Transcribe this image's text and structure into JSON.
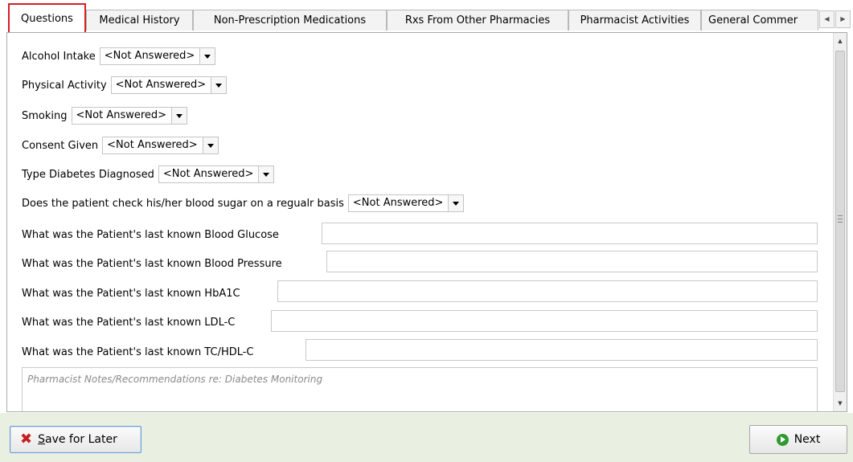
{
  "tabs": [
    {
      "label": "Questions",
      "active": true
    },
    {
      "label": "Medical History",
      "active": false
    },
    {
      "label": "Non-Prescription Medications",
      "active": false
    },
    {
      "label": "Rxs From Other Pharmacies",
      "active": false
    },
    {
      "label": "Pharmacist Activities",
      "active": false
    },
    {
      "label": "General Commer",
      "active": false
    }
  ],
  "tab_scroll": {
    "left_icon": "arrow-left-small-icon",
    "right_icon": "arrow-right-small-icon"
  },
  "questions": {
    "alcohol": {
      "label": "Alcohol Intake",
      "value": "<Not Answered>"
    },
    "activity": {
      "label": "Physical Activity",
      "value": "<Not Answered>"
    },
    "smoking": {
      "label": "Smoking",
      "value": "<Not Answered>"
    },
    "consent": {
      "label": "Consent Given",
      "value": "<Not Answered>"
    },
    "diabetes_type": {
      "label": "Type Diabetes Diagnosed",
      "value": "<Not Answered>"
    },
    "blood_sugar_check": {
      "label": "Does the patient check his/her blood sugar on a regualr basis",
      "value": "<Not Answered>"
    },
    "glucose": {
      "label": "What was the Patient's last known Blood Glucose",
      "value": ""
    },
    "pressure": {
      "label": "What was the Patient's last known Blood Pressure",
      "value": ""
    },
    "hba1c": {
      "label": "What was the Patient's last known HbA1C",
      "value": ""
    },
    "ldl": {
      "label": "What was the Patient's last known LDL-C",
      "value": ""
    },
    "tchdl": {
      "label": "What was the Patient's last known TC/HDL-C",
      "value": ""
    }
  },
  "notes": {
    "placeholder": "Pharmacist Notes/Recommendations re: Diabetes Monitoring"
  },
  "footer": {
    "save_first": "S",
    "save_rest": "ave for Later",
    "next_label": "Next"
  },
  "colors": {
    "active_tab_border": "#d51e26",
    "footer_bg": "#e9f0e2",
    "save_icon": "#c41f1f",
    "next_icon": "#2f9a2f"
  }
}
